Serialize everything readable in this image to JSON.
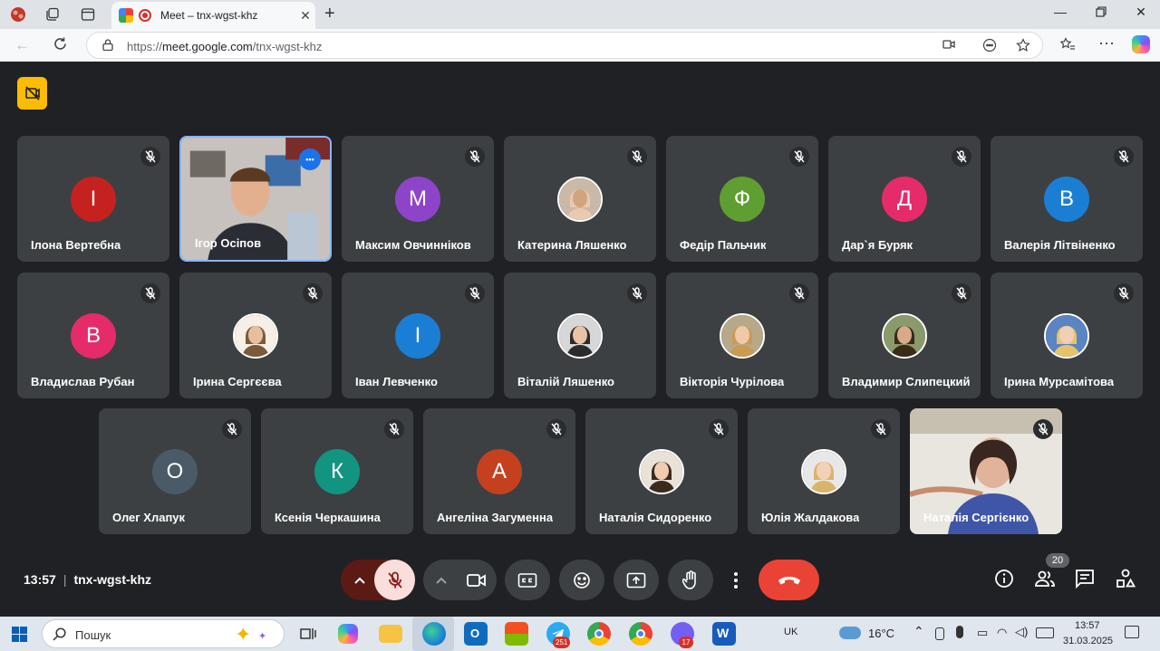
{
  "browser": {
    "tab_title": "Meet – tnx-wgst-khz",
    "url_prefix": "https://",
    "url_host": "meet.google.com",
    "url_path": "/tnx-wgst-khz"
  },
  "meeting": {
    "time": "13:57",
    "code": "tnx-wgst-khz",
    "participant_count": "20"
  },
  "participants": [
    {
      "name": "Ілона Вертебна",
      "initial": "І",
      "color": "#c5221f",
      "muted": true
    },
    {
      "name": "Ігор Осіпов",
      "video": true,
      "speaking": true,
      "muted": false
    },
    {
      "name": "Максим Овчинніков",
      "initial": "М",
      "color": "#8e44c9",
      "muted": true
    },
    {
      "name": "Катерина Ляшенко",
      "photo": true,
      "muted": true
    },
    {
      "name": "Федір Пальчик",
      "initial": "Ф",
      "color": "#5f9e31",
      "muted": true
    },
    {
      "name": "Дар`я Буряк",
      "initial": "Д",
      "color": "#e52b6a",
      "muted": true
    },
    {
      "name": "Валерія Літвіненко",
      "initial": "В",
      "color": "#1a7fd4",
      "muted": true
    },
    {
      "name": "Владислав Рубан",
      "initial": "В",
      "color": "#e52b6a",
      "muted": true
    },
    {
      "name": "Ірина Сергєєва",
      "photo": true,
      "muted": true
    },
    {
      "name": "Іван Левченко",
      "initial": "І",
      "color": "#1a7fd4",
      "muted": true
    },
    {
      "name": "Віталій Ляшенко",
      "photo": true,
      "muted": true
    },
    {
      "name": "Вікторія Чурілова",
      "photo": true,
      "muted": true
    },
    {
      "name": "Владимир Слипецкий",
      "photo": true,
      "muted": true
    },
    {
      "name": "Ірина Мурсамітова",
      "photo": true,
      "muted": true
    },
    {
      "name": "Олег Хлапук",
      "initial": "О",
      "color": "#4a5a66",
      "muted": true
    },
    {
      "name": "Ксенія Черкашина",
      "initial": "К",
      "color": "#129481",
      "muted": true
    },
    {
      "name": "Ангеліна Загуменна",
      "initial": "А",
      "color": "#c5401f",
      "muted": true
    },
    {
      "name": "Наталія Сидоренко",
      "photo": true,
      "muted": true
    },
    {
      "name": "Юлія Жалдакова",
      "photo": true,
      "muted": true
    },
    {
      "name": "Наталія Сергієнко",
      "video": true,
      "muted": true
    }
  ],
  "taskbar": {
    "search_placeholder": "Пошук",
    "language": "UK",
    "temperature": "16°C",
    "clock_time": "13:57",
    "clock_date": "31.03.2025",
    "telegram_badge": "251",
    "viber_badge": "17"
  },
  "colors": {
    "meet_bg": "#202124",
    "tile_bg": "#3c4043",
    "end_call": "#ea4335",
    "mic_off_bg": "#f9dedc",
    "active_border": "#8ab4f8",
    "host_badge": "#fbbc04"
  }
}
